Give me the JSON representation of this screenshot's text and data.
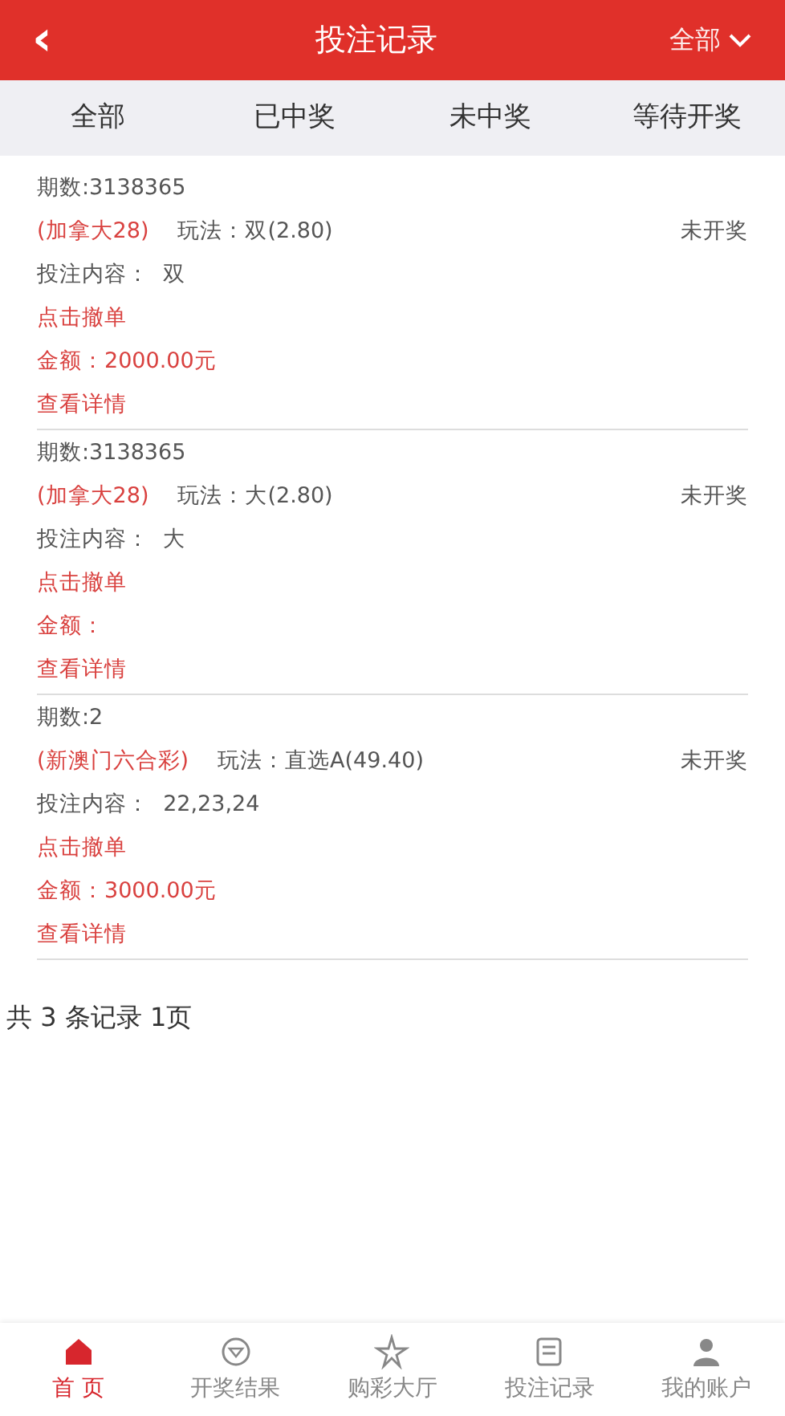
{
  "header": {
    "back": "‹",
    "title": "投注记录",
    "filter": "全部"
  },
  "tabs": [
    {
      "label": "全部",
      "selected": false
    },
    {
      "label": "已中奖",
      "selected": false
    },
    {
      "label": "未中奖",
      "selected": false
    },
    {
      "label": "等待开奖",
      "selected": false
    }
  ],
  "records": [
    {
      "period": "期数:3138365",
      "lottery": "(加拿大28)",
      "play": "玩法：双(2.80)",
      "status": "未开奖",
      "content": "投注内容：  双",
      "cancel": "点击撤单",
      "amount": "金额：2000.00元",
      "details": "查看详情"
    },
    {
      "period": "期数:3138365",
      "lottery": "(加拿大28)",
      "play": "玩法：大(2.80)",
      "status": "未开奖",
      "content": "投注内容：  大",
      "cancel": "点击撤单",
      "amount": "金额：",
      "details": "查看详情"
    },
    {
      "period": "期数:2",
      "lottery": "(新澳门六合彩)",
      "play": "玩法：直选A(49.40)",
      "status": "未开奖",
      "content": "投注内容：  22,23,24",
      "cancel": "点击撤单",
      "amount": "金额：3000.00元",
      "details": "查看详情"
    }
  ],
  "summary": "共 3 条记录 1页",
  "nav": [
    {
      "kind": "home",
      "label": "首 页",
      "selected": true
    },
    {
      "kind": "results",
      "label": "开奖结果",
      "selected": false
    },
    {
      "kind": "hall",
      "label": "购彩大厅",
      "selected": false
    },
    {
      "kind": "records",
      "label": "投注记录",
      "selected": false
    },
    {
      "kind": "account",
      "label": "我的账户",
      "selected": false
    }
  ]
}
